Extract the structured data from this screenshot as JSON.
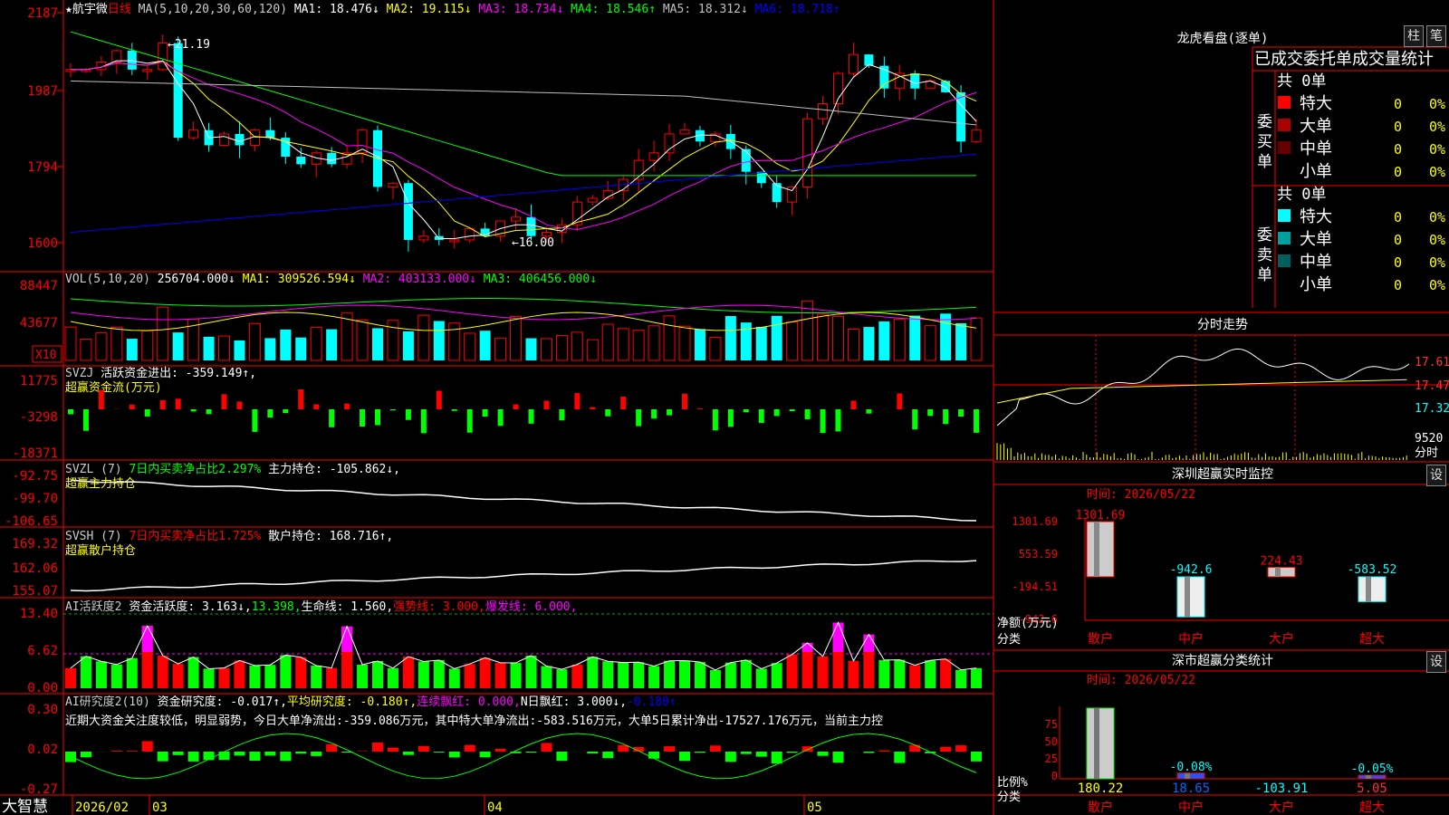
{
  "stock": {
    "star": "★",
    "name": "航宇微",
    "period": "日线"
  },
  "main_chart": {
    "ma_params": "MA(5,10,20,30,60,120)",
    "ma_lines": [
      {
        "label": "MA1:",
        "value": "18.476",
        "arrow": "↓",
        "color": "#ffffff"
      },
      {
        "label": "MA2:",
        "value": "19.115",
        "arrow": "↓",
        "color": "#ffff00"
      },
      {
        "label": "MA3:",
        "value": "18.734",
        "arrow": "↓",
        "color": "#ff00ff"
      },
      {
        "label": "MA4:",
        "value": "18.546",
        "arrow": "↑",
        "color": "#00ff00"
      },
      {
        "label": "MA5:",
        "value": "18.312",
        "arrow": "↓",
        "color": "#c0c0c0"
      },
      {
        "label": "MA6:",
        "value": "18.718",
        "arrow": "↑",
        "color": "#0000ff"
      }
    ],
    "y_ticks": [
      "2187",
      "1987",
      "1794",
      "1600"
    ],
    "high_label": "21.19",
    "low_label": "16.00"
  },
  "volume": {
    "params": "VOL(5,10,20)",
    "value": "256704.000",
    "arrow": "↓",
    "lines": [
      {
        "label": "MA1:",
        "value": "309526.594",
        "arrow": "↓",
        "color": "#ffff00"
      },
      {
        "label": "MA2:",
        "value": "403133.000",
        "arrow": "↓",
        "color": "#ff00ff"
      },
      {
        "label": "MA3:",
        "value": "406456.000",
        "arrow": "↓",
        "color": "#00ff00"
      }
    ],
    "y_ticks": [
      "88447",
      "43677"
    ],
    "unit": "X10"
  },
  "svzj": {
    "name": "SVZJ",
    "label": "活跃资金进出:",
    "value": "-359.149",
    "arrow": "↑",
    "subtitle": "超赢资金流(万元)",
    "y_ticks": [
      "11775",
      "-3298",
      "-18371"
    ]
  },
  "svzl": {
    "name": "SVZL (7)",
    "ratio": "7日内买卖净占比2.297%",
    "label": "主力持仓:",
    "value": "-105.862",
    "arrow": "↓",
    "subtitle": "超赢主力持仓",
    "y_ticks": [
      "-92.75",
      "-99.70",
      "-106.65"
    ]
  },
  "svsh": {
    "name": "SVSH (7)",
    "ratio": "7日内买卖净占比1.725%",
    "label": "散户持仓:",
    "value": "168.716",
    "arrow": "↑",
    "subtitle": "超赢散户持仓",
    "y_ticks": [
      "169.32",
      "162.06",
      "155.07"
    ]
  },
  "ai_active": {
    "name": "AI活跃度2",
    "label": "资金活跃度:",
    "value": "3.163",
    "arrow": "↓",
    "value2": "13.398",
    "life_label": "生命线:",
    "life_value": "1.560",
    "strong_label": "强势线:",
    "strong_value": "3.000",
    "burst_label": "爆发线:",
    "burst_value": "6.000",
    "y_ticks": [
      "13.40",
      "6.62",
      "0.00"
    ]
  },
  "ai_research": {
    "name": "AI研究度2(10)",
    "label": "资金研究度:",
    "value": "-0.017",
    "avg_label": "平均研究度:",
    "avg_value": "-0.180",
    "red_label": "连续飘红:",
    "red_value": "0.000",
    "nred_label": "N日飘红:",
    "nred_value": "3.000",
    "last_value": "-0.180",
    "commentary": "近期大资金关注度较低，明显弱势，今日大单净流出:-359.086万元，其中特大单净流出:-583.516万元，大单5日累计净出-17527.176万元，当前主力控",
    "y_ticks": [
      "0.30",
      "0.02",
      "-0.27"
    ]
  },
  "bottom_axis": {
    "brand": "大智慧",
    "labels": [
      "2026/02",
      "03",
      "04",
      "05"
    ]
  },
  "dragon_tiger": {
    "title": "龙虎看盘(逐单)",
    "tab1": "柱",
    "tab2": "笔",
    "header": "已成交委托单成交量统计",
    "buy_side": "委买单",
    "sell_side": "委卖单",
    "buy_count": "共 0单",
    "sell_count": "共 0单",
    "buy_rows": [
      {
        "label": "特大",
        "vol": "0",
        "pct": "0%",
        "color": "#ff0000"
      },
      {
        "label": "大单",
        "vol": "0",
        "pct": "0%",
        "color": "#aa0000"
      },
      {
        "label": "中单",
        "vol": "0",
        "pct": "0%",
        "color": "#660000"
      },
      {
        "label": "小单",
        "vol": "0",
        "pct": "0%",
        "color": "#000000"
      }
    ],
    "sell_rows": [
      {
        "label": "特大",
        "vol": "0",
        "pct": "0%",
        "color": "#00ffff"
      },
      {
        "label": "大单",
        "vol": "0",
        "pct": "0%",
        "color": "#00a0a0"
      },
      {
        "label": "中单",
        "vol": "0",
        "pct": "0%",
        "color": "#006060"
      },
      {
        "label": "小单",
        "vol": "0",
        "pct": "0%",
        "color": "#000000"
      }
    ]
  },
  "intraday": {
    "title": "分时走势",
    "prices": [
      "17.61",
      "17.47",
      "17.32"
    ],
    "volume": "9520",
    "unit_label": "分时"
  },
  "monitor": {
    "title": "深圳超赢实时监控",
    "settings": "设",
    "time_label": "时间: 2026/05/22",
    "y_ticks": [
      "1301.69",
      "553.59",
      "-194.51",
      "-942.6"
    ],
    "net_label": "净额(万元)",
    "cat_label": "分类",
    "bars": [
      {
        "cat": "散户",
        "value": 1301.69,
        "text": "1301.69"
      },
      {
        "cat": "中户",
        "value": -942.6,
        "text": "-942.6"
      },
      {
        "cat": "大户",
        "value": 224.43,
        "text": "224.43"
      },
      {
        "cat": "超大",
        "value": -583.52,
        "text": "-583.52"
      }
    ]
  },
  "classify": {
    "title": "深市超赢分类统计",
    "settings": "设",
    "time_label": "时间: 2026/05/22",
    "y_ticks": [
      "75",
      "50",
      "25",
      "0"
    ],
    "ratio_label": "比例%",
    "cat_label": "分类",
    "bars": [
      {
        "cat": "散户",
        "pct": 100,
        "value": "180.22",
        "label": ""
      },
      {
        "cat": "中户",
        "pct": 8,
        "value": "18.65",
        "label": "-0.08%"
      },
      {
        "cat": "大户",
        "pct": 0,
        "value": "-103.91",
        "label": ""
      },
      {
        "cat": "超大",
        "pct": 5,
        "value": "5.05",
        "label": "-0.05%"
      }
    ]
  }
}
